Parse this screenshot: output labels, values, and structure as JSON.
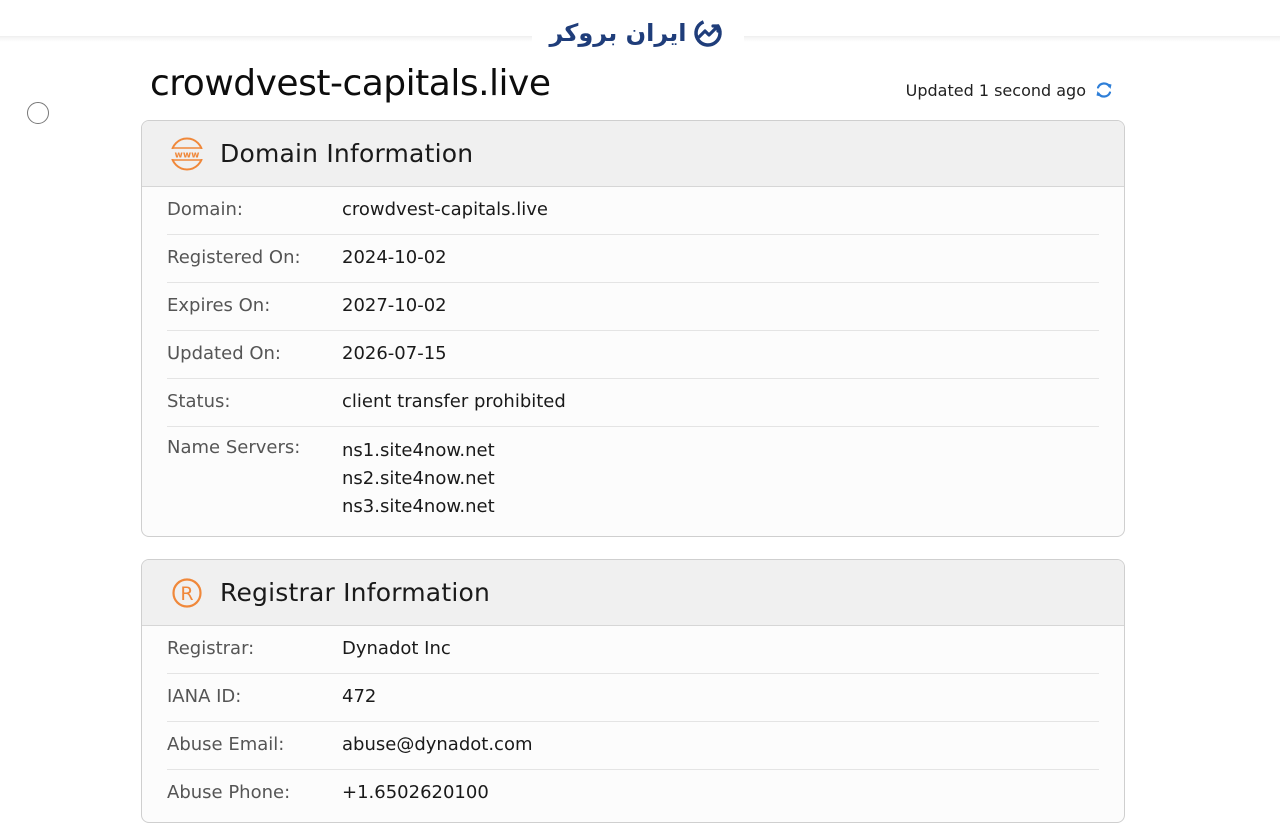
{
  "header": {
    "logo_text": "ایران بروکر"
  },
  "page": {
    "title": "crowdvest-capitals.live",
    "updated_text": "Updated 1 second ago"
  },
  "domain_info": {
    "title": "Domain Information",
    "rows": [
      {
        "label": "Domain:",
        "value": "crowdvest-capitals.live"
      },
      {
        "label": "Registered On:",
        "value": "2024-10-02"
      },
      {
        "label": "Expires On:",
        "value": "2027-10-02"
      },
      {
        "label": "Updated On:",
        "value": "2026-07-15"
      },
      {
        "label": "Status:",
        "value": "client transfer prohibited"
      }
    ],
    "name_servers": {
      "label": "Name Servers:",
      "values": [
        "ns1.site4now.net",
        "ns2.site4now.net",
        "ns3.site4now.net"
      ]
    }
  },
  "registrar_info": {
    "title": "Registrar Information",
    "rows": [
      {
        "label": "Registrar:",
        "value": "Dynadot Inc"
      },
      {
        "label": "IANA ID:",
        "value": "472"
      },
      {
        "label": "Abuse Email:",
        "value": "abuse@dynadot.com"
      },
      {
        "label": "Abuse Phone:",
        "value": "+1.6502620100"
      }
    ]
  },
  "icons": {
    "domain_header": "www-globe-icon",
    "registrar_header": "registered-trademark-icon",
    "refresh": "refresh-icon",
    "logo": "chart-trend-icon"
  },
  "colors": {
    "accent_orange": "#f0883a",
    "refresh_blue": "#2f7fd8",
    "logo_navy": "#1f3d7a"
  }
}
